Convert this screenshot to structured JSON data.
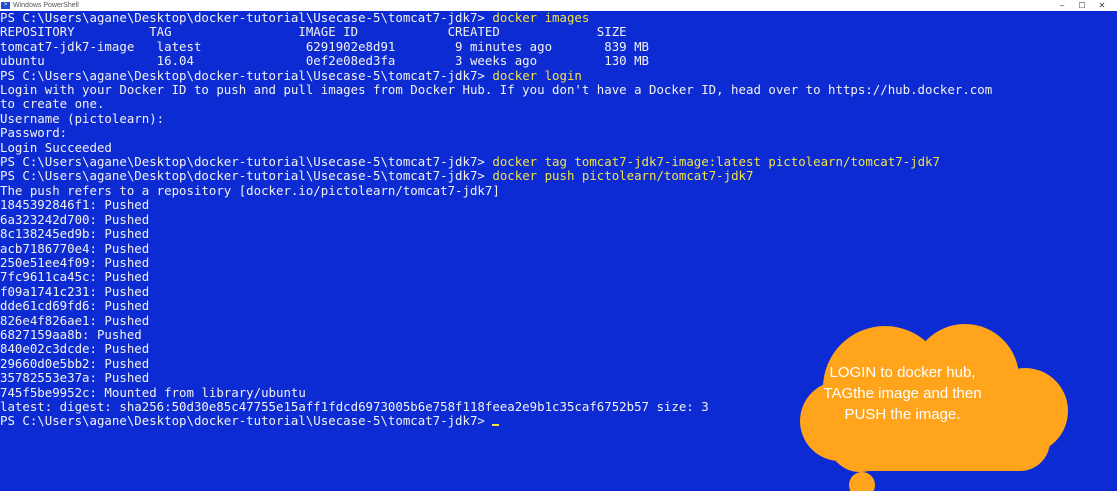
{
  "window": {
    "title": "Windows PowerShell",
    "controls": {
      "minimize": "–",
      "maximize": "☐",
      "close": "✕"
    }
  },
  "terminal": {
    "prompt": "PS C:\\Users\\agane\\Desktop\\docker-tutorial\\Usecase-5\\tomcat7-jdk7>",
    "commands": {
      "images": "docker images",
      "login": "docker login",
      "tag": "docker tag tomcat7-jdk7-image:latest pictolearn/tomcat7-jdk7",
      "push": "docker push pictolearn/tomcat7-jdk7"
    },
    "images_header": "REPOSITORY          TAG                 IMAGE ID            CREATED             SIZE",
    "images_rows": [
      "tomcat7-jdk7-image   latest              6291902e8d91        9 minutes ago       839 MB",
      "ubuntu               16.04               0ef2e08ed3fa        3 weeks ago         130 MB"
    ],
    "login_output": [
      "Login with your Docker ID to push and pull images from Docker Hub. If you don't have a Docker ID, head over to https://hub.docker.com",
      "to create one.",
      "Username (pictolearn):",
      "Password:",
      "Login Succeeded"
    ],
    "push_intro": "The push refers to a repository [docker.io/pictolearn/tomcat7-jdk7]",
    "push_layers": [
      "1845392846f1: Pushed",
      "6a323242d700: Pushed",
      "8c138245ed9b: Pushed",
      "acb7186770e4: Pushed",
      "250e51ee4f09: Pushed",
      "7fc9611ca45c: Pushed",
      "f09a1741c231: Pushed",
      "dde61cd69fd6: Pushed",
      "826e4f826ae1: Pushed",
      "6827159aa8b: Pushed",
      "840e02c3dcde: Pushed",
      "29660d0e5bb2: Pushed",
      "35782553e37a: Pushed",
      "745f5be9952c: Mounted from library/ubuntu"
    ],
    "digest_line": "latest: digest: sha256:50d30e85c47755e15aff1fdcd6973005b6e758f118feea2e9b1c35caf6752b57 size: 3"
  },
  "callout": {
    "text": "LOGIN to docker hub, TAGthe image and then PUSH the image.",
    "color": "#ffa41b"
  },
  "colors": {
    "background": "#0c2bd3",
    "text": "#f2f2f2",
    "command": "#f1e24a"
  }
}
